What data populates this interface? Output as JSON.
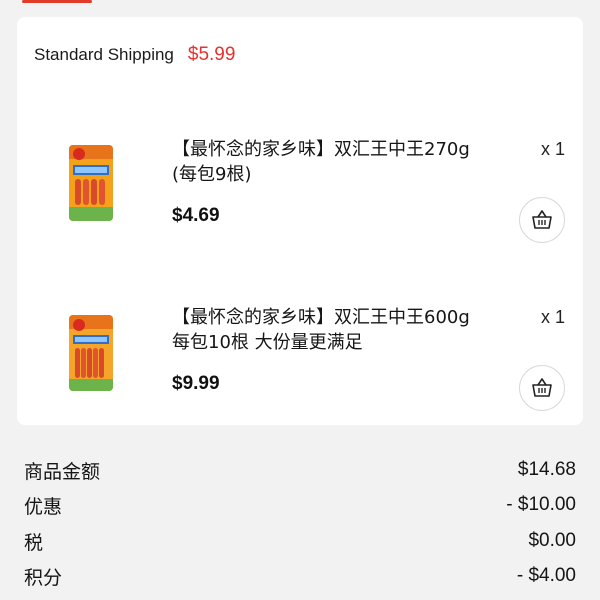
{
  "shipping": {
    "label": "Standard Shipping",
    "price": "$5.99"
  },
  "items": [
    {
      "title_line1": "【最怀念的家乡味】双汇王中王270g",
      "title_line2": "(每包9根)",
      "quantity": "x 1",
      "price": "$4.69",
      "image_icon": "sausage-pack-thumbnail"
    },
    {
      "title_line1": "【最怀念的家乡味】双汇王中王600g",
      "title_line2": "每包10根 大份量更满足",
      "quantity": "x 1",
      "price": "$9.99",
      "image_icon": "sausage-pack-thumbnail"
    }
  ],
  "summary": [
    {
      "label": "商品金额",
      "value": "$14.68"
    },
    {
      "label": "优惠",
      "value": "- $10.00"
    },
    {
      "label": "税",
      "value": "$0.00"
    },
    {
      "label": "积分",
      "value": "- $4.00"
    }
  ],
  "colors": {
    "accent_red": "#e5322d",
    "background": "#f2f2f2",
    "card": "#ffffff"
  }
}
